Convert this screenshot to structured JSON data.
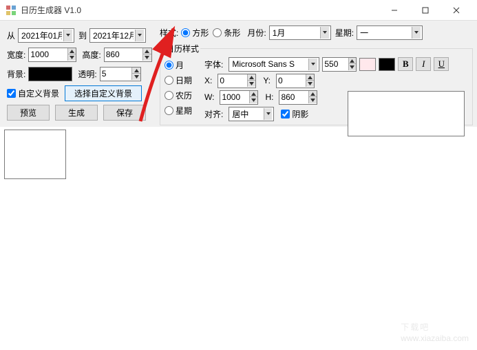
{
  "window": {
    "title": "日历生成器 V1.0"
  },
  "range": {
    "from_label": "从",
    "from_value": "2021年01月",
    "to_label": "到",
    "to_value": "2021年12月"
  },
  "size": {
    "width_label": "宽度:",
    "width_value": "1000",
    "height_label": "高度:",
    "height_value": "860"
  },
  "bg": {
    "bg_label": "背景:",
    "bg_color": "#000000",
    "alpha_label": "透明:",
    "alpha_value": "5"
  },
  "custom_bg": {
    "check_label": "自定义背景",
    "choose_btn": "选择自定义背景"
  },
  "actions": {
    "preview": "预览",
    "generate": "生成",
    "save": "保存"
  },
  "style": {
    "label": "样式:",
    "square": "方形",
    "strip": "条形",
    "month_label": "月份:",
    "month_value": "1月",
    "week_label": "星期:",
    "week_value": "一"
  },
  "cal_style": {
    "legend": "日历样式",
    "opts": {
      "month": "月",
      "date": "日期",
      "lunar": "农历",
      "week": "星期"
    },
    "font_label": "字体:",
    "font_value": "Microsoft Sans S",
    "font_size": "550",
    "x_label": "X:",
    "x_value": "0",
    "y_label": "Y:",
    "y_value": "0",
    "w_label": "W:",
    "w_value": "1000",
    "h_label": "H:",
    "h_value": "860",
    "align_label": "对齐:",
    "align_value": "居中",
    "shadow_label": "阴影",
    "swatch_light": "#ffe8ec",
    "swatch_dark": "#000000"
  },
  "watermark": {
    "big": "下载吧",
    "url": "www.xiazaiba.com"
  }
}
